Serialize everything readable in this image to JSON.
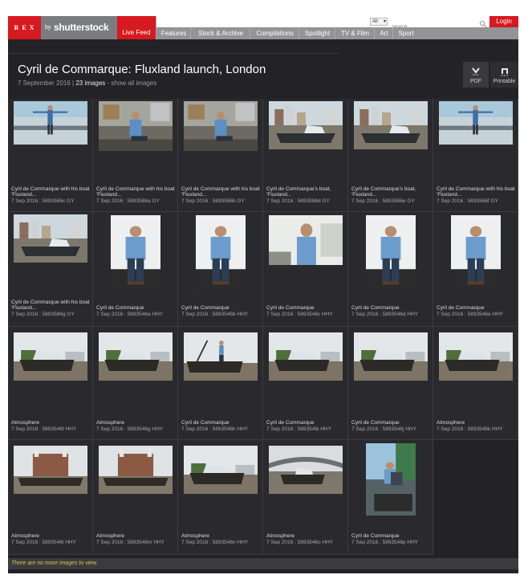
{
  "search": {
    "filter": "All",
    "placeholder": "Search"
  },
  "header_bar": {
    "login_label": "Login"
  },
  "logo": {
    "rex": "REX",
    "by": "by",
    "brand": "shutterstock"
  },
  "nav": [
    "Live Feed",
    "Features",
    "Stock & Archive",
    "Compilations",
    "Spotlight",
    "TV & Film",
    "Art",
    "Sport"
  ],
  "page": {
    "title": "Cyril de Commarque: Fluxland launch, London",
    "date": "7 September 2016",
    "separator": " | ",
    "count": "23 images",
    "show_all": " - show all images",
    "pdf_label": "PDF",
    "printable_label": "Printable"
  },
  "images": [
    {
      "caption": "Cyril de Commarque with his boat 'Fluxland...",
      "meta": "7 Sep 2016 : 5893586c GY",
      "scene": "arms"
    },
    {
      "caption": "Cyril de Commarque with his boat 'Fluxland...",
      "meta": "7 Sep 2016 : 5893586a GY",
      "scene": "seated"
    },
    {
      "caption": "Cyril de Commarque with his boat 'Fluxland...",
      "meta": "7 Sep 2016 : 5893586b GY",
      "scene": "seated"
    },
    {
      "caption": "Cyril de Commarque's boat, 'Fluxland...",
      "meta": "7 Sep 2016 : 5893586d GY",
      "scene": "boat-city"
    },
    {
      "caption": "Cyril de Commarque's boat, 'Fluxland...",
      "meta": "7 Sep 2016 : 5893586e GY",
      "scene": "boat-city"
    },
    {
      "caption": "Cyril de Commarque with his boat 'Fluxland...",
      "meta": "7 Sep 2016 : 5893586f GY",
      "scene": "arms"
    },
    {
      "caption": "Cyril de Commarque with his boat 'Fluxland...",
      "meta": "7 Sep 2016 : 5893586g GY",
      "scene": "boat-city"
    },
    {
      "caption": "Cyril de Commarque",
      "meta": "7 Sep 2016 : 5893546a HHY",
      "scene": "portrait"
    },
    {
      "caption": "Cyril de Commarque",
      "meta": "7 Sep 2016 : 5893546b HHY",
      "scene": "portrait"
    },
    {
      "caption": "Cyril de Commarque",
      "meta": "7 Sep 2016 : 5893546c HHY",
      "scene": "portrait-wide"
    },
    {
      "caption": "Cyril de Commarque",
      "meta": "7 Sep 2016 : 5893546d HHY",
      "scene": "portrait"
    },
    {
      "caption": "Cyril de Commarque",
      "meta": "7 Sep 2016 : 5893546e HHY",
      "scene": "portrait"
    },
    {
      "caption": "Atmosphere",
      "meta": "7 Sep 2016 : 5893546f HHY",
      "scene": "barge"
    },
    {
      "caption": "Atmosphere",
      "meta": "7 Sep 2016 : 5893546g HHY",
      "scene": "barge"
    },
    {
      "caption": "Cyril de Commarque",
      "meta": "7 Sep 2016 : 5893546h HHY",
      "scene": "barge-man"
    },
    {
      "caption": "Cyril de Commarque",
      "meta": "7 Sep 2016 : 5893546i HHY",
      "scene": "barge"
    },
    {
      "caption": "Cyril de Commarque",
      "meta": "7 Sep 2016 : 5893546j HHY",
      "scene": "barge"
    },
    {
      "caption": "Atmosphere",
      "meta": "7 Sep 2016 : 5893546k HHY",
      "scene": "barge"
    },
    {
      "caption": "Atmosphere",
      "meta": "7 Sep 2016 : 5893546l HHY",
      "scene": "station"
    },
    {
      "caption": "Atmosphere",
      "meta": "7 Sep 2016 : 5893546m HHY",
      "scene": "station"
    },
    {
      "caption": "Atmosphere",
      "meta": "7 Sep 2016 : 5893546n HHY",
      "scene": "barge"
    },
    {
      "caption": "Atmosphere",
      "meta": "7 Sep 2016 : 5893546o HHY",
      "scene": "bridge"
    },
    {
      "caption": "Cyril de Commarque",
      "meta": "7 Sep 2016 : 5893546p HHY",
      "scene": "portrait-tall"
    }
  ],
  "footer": {
    "no_more": "There are no more images to view."
  },
  "colors": {
    "accent": "#d71920",
    "nav": "#929497",
    "background": "#232327",
    "notice": "#e0c246"
  }
}
